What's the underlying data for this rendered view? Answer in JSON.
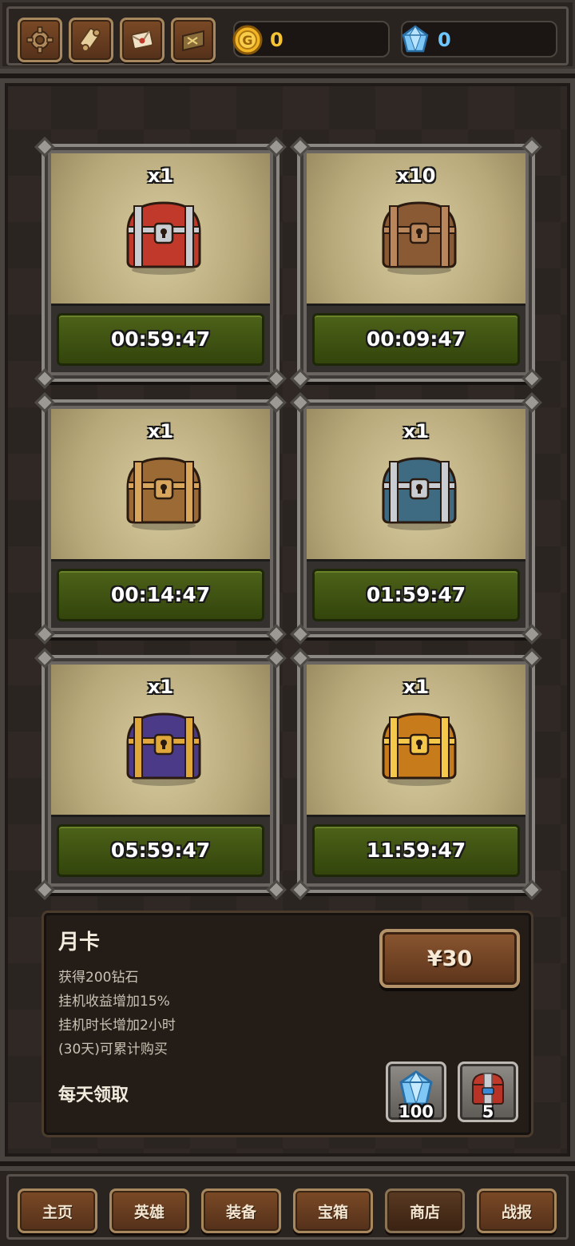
{
  "topbar": {
    "buttons": [
      {
        "name": "settings-button",
        "icon": "gear-icon"
      },
      {
        "name": "scroll-button",
        "icon": "scroll-icon"
      },
      {
        "name": "mail-button",
        "icon": "envelope-icon"
      },
      {
        "name": "map-button",
        "icon": "treasure-map-icon"
      }
    ],
    "gold": {
      "icon": "gold-coin-icon",
      "value": "0"
    },
    "gems": {
      "icon": "diamond-icon",
      "value": "0"
    }
  },
  "chests": [
    {
      "qty": "x1",
      "timer": "00:59:47",
      "type": "red-silver-chest-icon",
      "colors": {
        "body": "#c0392b",
        "trim": "#c9ccd1"
      }
    },
    {
      "qty": "x10",
      "timer": "00:09:47",
      "type": "wooden-chest-icon",
      "colors": {
        "body": "#8a5a35",
        "trim": "#b8865a"
      }
    },
    {
      "qty": "x1",
      "timer": "00:14:47",
      "type": "bronze-chest-icon",
      "colors": {
        "body": "#9b6a35",
        "trim": "#d8a55c"
      }
    },
    {
      "qty": "x1",
      "timer": "01:59:47",
      "type": "silver-chest-icon",
      "colors": {
        "body": "#3e6a82",
        "trim": "#c9ccd1"
      }
    },
    {
      "qty": "x1",
      "timer": "05:59:47",
      "type": "purple-gold-chest-icon",
      "colors": {
        "body": "#4b3a88",
        "trim": "#e0a83a"
      }
    },
    {
      "qty": "x1",
      "timer": "11:59:47",
      "type": "golden-chest-icon",
      "colors": {
        "body": "#c77b1a",
        "trim": "#f4c84a"
      }
    }
  ],
  "month_card": {
    "title": "月卡",
    "lines": [
      "获得200钻石",
      "挂机收益增加15%",
      "挂机时长增加2小时",
      "(30天)可累计购买"
    ],
    "daily_label": "每天领取",
    "price": "¥30",
    "rewards": [
      {
        "icon": "diamond-icon",
        "count": "100"
      },
      {
        "icon": "red-silver-chest-icon",
        "count": "5"
      }
    ]
  },
  "nav": [
    "主页",
    "英雄",
    "装备",
    "宝箱",
    "商店",
    "战报"
  ],
  "active_nav": "商店"
}
